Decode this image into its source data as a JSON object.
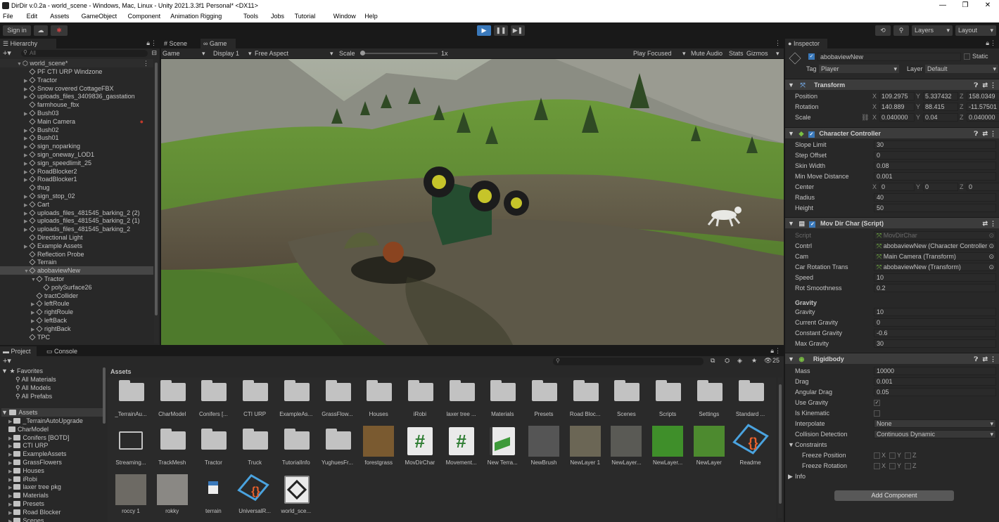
{
  "window": {
    "title": "DirDir v.0.2a - world_scene - Windows, Mac, Linux - Unity 2021.3.3f1 Personal* <DX11>"
  },
  "menu": [
    "File",
    "Edit",
    "Assets",
    "GameObject",
    "Component",
    "Animation Rigging",
    "Tools",
    "Jobs",
    "Tutorial",
    "Window",
    "Help"
  ],
  "toolbar": {
    "sign_in": "Sign in",
    "layers": "Layers",
    "layout": "Layout"
  },
  "hierarchy": {
    "tab": "Hierarchy",
    "search_placeholder": "All",
    "scene": "world_scene*",
    "items": [
      {
        "name": "PF CTI URP Windzone",
        "indent": 1,
        "arrow": ""
      },
      {
        "name": "Tractor",
        "indent": 1,
        "arrow": "▶"
      },
      {
        "name": "Snow covered CottageFBX",
        "indent": 1,
        "arrow": "▶"
      },
      {
        "name": "uploads_files_3409836_gasstation",
        "indent": 1,
        "arrow": "▶"
      },
      {
        "name": "farmhouse_fbx",
        "indent": 1,
        "arrow": ""
      },
      {
        "name": "Bush03",
        "indent": 1,
        "arrow": "▶"
      },
      {
        "name": "Main Camera",
        "indent": 1,
        "arrow": ""
      },
      {
        "name": "Bush02",
        "indent": 1,
        "arrow": "▶"
      },
      {
        "name": "Bush01",
        "indent": 1,
        "arrow": "▶"
      },
      {
        "name": "sign_noparking",
        "indent": 1,
        "arrow": "▶"
      },
      {
        "name": "sign_oneway_LOD1",
        "indent": 1,
        "arrow": "▶"
      },
      {
        "name": "sign_speedlimit_25",
        "indent": 1,
        "arrow": "▶"
      },
      {
        "name": "RoadBlocker2",
        "indent": 1,
        "arrow": "▶"
      },
      {
        "name": "RoadBlocker1",
        "indent": 1,
        "arrow": "▶"
      },
      {
        "name": "thug",
        "indent": 1,
        "arrow": ""
      },
      {
        "name": "sign_stop_02",
        "indent": 1,
        "arrow": "▶"
      },
      {
        "name": "Cart",
        "indent": 1,
        "arrow": "▶"
      },
      {
        "name": "uploads_files_481545_barking_2 (2)",
        "indent": 1,
        "arrow": "▶"
      },
      {
        "name": "uploads_files_481545_barking_2 (1)",
        "indent": 1,
        "arrow": "▶"
      },
      {
        "name": "uploads_files_481545_barking_2",
        "indent": 1,
        "arrow": "▶"
      },
      {
        "name": "Directional Light",
        "indent": 1,
        "arrow": ""
      },
      {
        "name": "Example Assets",
        "indent": 1,
        "arrow": "▶"
      },
      {
        "name": "Reflection Probe",
        "indent": 1,
        "arrow": ""
      },
      {
        "name": "Terrain",
        "indent": 1,
        "arrow": ""
      },
      {
        "name": "abobaviewNew",
        "indent": 1,
        "arrow": "▼",
        "selected": true
      },
      {
        "name": "Tractor",
        "indent": 2,
        "arrow": "▼"
      },
      {
        "name": "polySurface26",
        "indent": 3,
        "arrow": ""
      },
      {
        "name": "tractCollider",
        "indent": 2,
        "arrow": ""
      },
      {
        "name": "leftRoule",
        "indent": 2,
        "arrow": "▶"
      },
      {
        "name": "rightRoule",
        "indent": 2,
        "arrow": "▶"
      },
      {
        "name": "leftBack",
        "indent": 2,
        "arrow": "▶"
      },
      {
        "name": "rightBack",
        "indent": 2,
        "arrow": "▶"
      },
      {
        "name": "TPC",
        "indent": 1,
        "arrow": ""
      }
    ]
  },
  "game": {
    "tabs": [
      "Scene",
      "Game"
    ],
    "display_mode": "Game",
    "display": "Display 1",
    "aspect": "Free Aspect",
    "scale_label": "Scale",
    "scale_value": "1x",
    "play_focused": "Play Focused",
    "mute": "Mute Audio",
    "stats": "Stats",
    "gizmos": "Gizmos"
  },
  "inspector": {
    "tab": "Inspector",
    "object_name": "abobaviewNew",
    "static": "Static",
    "tag_label": "Tag",
    "tag": "Player",
    "layer_label": "Layer",
    "layer": "Default",
    "transform": {
      "title": "Transform",
      "rows": [
        {
          "label": "Position",
          "x": "109.2975",
          "y": "5.337432",
          "z": "158.0349"
        },
        {
          "label": "Rotation",
          "x": "140.889",
          "y": "88.415",
          "z": "-11.57501"
        },
        {
          "label": "Scale",
          "x": "0.040000",
          "y": "0.04",
          "z": "0.040000"
        }
      ]
    },
    "character_controller": {
      "title": "Character Controller",
      "rows": [
        {
          "label": "Slope Limit",
          "value": "30"
        },
        {
          "label": "Step Offset",
          "value": "0"
        },
        {
          "label": "Skin Width",
          "value": "0.08"
        },
        {
          "label": "Min Move Distance",
          "value": "0.001"
        }
      ],
      "center_label": "Center",
      "center": {
        "x": "0",
        "y": "0",
        "z": "0"
      },
      "rows2": [
        {
          "label": "Radius",
          "value": "40"
        },
        {
          "label": "Height",
          "value": "50"
        }
      ]
    },
    "mov_dir_char": {
      "title": "Mov Dir Char (Script)",
      "rows": [
        {
          "label": "Script",
          "value": "MovDirChar",
          "dim": true
        },
        {
          "label": "Contrl",
          "value": "abobaviewNew (Character Controller"
        },
        {
          "label": "Cam",
          "value": "Main Camera (Transform)"
        },
        {
          "label": "Car Rotation Trans",
          "value": "abobaviewNew (Transform)"
        },
        {
          "label": "Speed",
          "value": "10"
        },
        {
          "label": "Rot Smoothness",
          "value": "0.2"
        }
      ],
      "gravity_header": "Gravity",
      "gravity_rows": [
        {
          "label": "Gravity",
          "value": "10"
        },
        {
          "label": "Current Gravity",
          "value": "0"
        },
        {
          "label": "Constant Gravity",
          "value": "-0.6"
        },
        {
          "label": "Max Gravity",
          "value": "30"
        }
      ]
    },
    "rigidbody": {
      "title": "Rigidbody",
      "rows": [
        {
          "label": "Mass",
          "value": "10000"
        },
        {
          "label": "Drag",
          "value": "0.001"
        },
        {
          "label": "Angular Drag",
          "value": "0.05"
        }
      ],
      "use_gravity": "Use Gravity",
      "is_kinematic": "Is Kinematic",
      "interpolate_label": "Interpolate",
      "interpolate": "None",
      "collision_label": "Collision Detection",
      "collision": "Continuous Dynamic",
      "constraints": "Constraints",
      "freeze_position": "Freeze Position",
      "freeze_rotation": "Freeze Rotation",
      "info": "Info"
    },
    "add_component": "Add Component"
  },
  "project": {
    "tabs": [
      "Project",
      "Console"
    ],
    "favorites": "Favorites",
    "fav_items": [
      "All Materials",
      "All Models",
      "All Prefabs"
    ],
    "assets_root": "Assets",
    "tree": [
      "_TerrainAutoUpgrade",
      "CharModel",
      "Conifers [BOTD]",
      "CTI URP",
      "ExampleAssets",
      "GrassFlowers",
      "Houses",
      "iRobi",
      "laxer tree pkg",
      "Materials",
      "Presets",
      "Road Blocker",
      "Scenes"
    ],
    "breadcrumb": "Assets",
    "count": "25",
    "row1": [
      "_TerrainAu...",
      "CharModel",
      "Conifers [...",
      "CTI URP",
      "ExampleAs...",
      "GrassFlow...",
      "Houses",
      "iRobi",
      "laxer tree ...",
      "Materials",
      "Presets",
      "Road Bloc...",
      "Scenes",
      "Scripts",
      "Settings",
      "Standard ..."
    ],
    "row2": [
      "Streaming...",
      "TrackMesh",
      "Tractor",
      "Truck",
      "TutorialInfo",
      "YughuesFr...",
      "forestgrass",
      "MovDirChar",
      "Movement...",
      "New Terra...",
      "NewBrush",
      "NewLayer 1",
      "NewLayer...",
      "NewLayer...",
      "NewLayer",
      "Readme"
    ],
    "row3": [
      "roccy 1",
      "rokky",
      "terrain",
      "UniversalR...",
      "world_sce..."
    ]
  },
  "colors": {
    "accent": "#3a79bb",
    "selected": "#2c5d87",
    "panel": "#282828"
  }
}
